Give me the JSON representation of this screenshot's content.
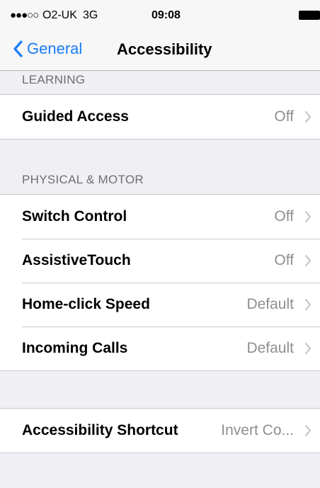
{
  "status_bar": {
    "signal": "●●●○○",
    "carrier": "O2-UK",
    "network": "3G",
    "time": "09:08"
  },
  "nav": {
    "back_label": "General",
    "title": "Accessibility"
  },
  "sections": {
    "learning": {
      "header": "LEARNING",
      "rows": [
        {
          "label": "Guided Access",
          "value": "Off"
        }
      ]
    },
    "physical_motor": {
      "header": "PHYSICAL & MOTOR",
      "rows": [
        {
          "label": "Switch Control",
          "value": "Off"
        },
        {
          "label": "AssistiveTouch",
          "value": "Off"
        },
        {
          "label": "Home-click Speed",
          "value": "Default"
        },
        {
          "label": "Incoming Calls",
          "value": "Default"
        }
      ]
    },
    "shortcut": {
      "rows": [
        {
          "label": "Accessibility Shortcut",
          "value": "Invert Co..."
        }
      ]
    }
  },
  "colors": {
    "accent": "#1a7cf5",
    "background": "#efeff4",
    "secondary_text": "#8e8e93"
  },
  "icons": {
    "back": "chevron-left-icon",
    "disclosure": "chevron-right-icon",
    "battery": "battery-icon"
  }
}
